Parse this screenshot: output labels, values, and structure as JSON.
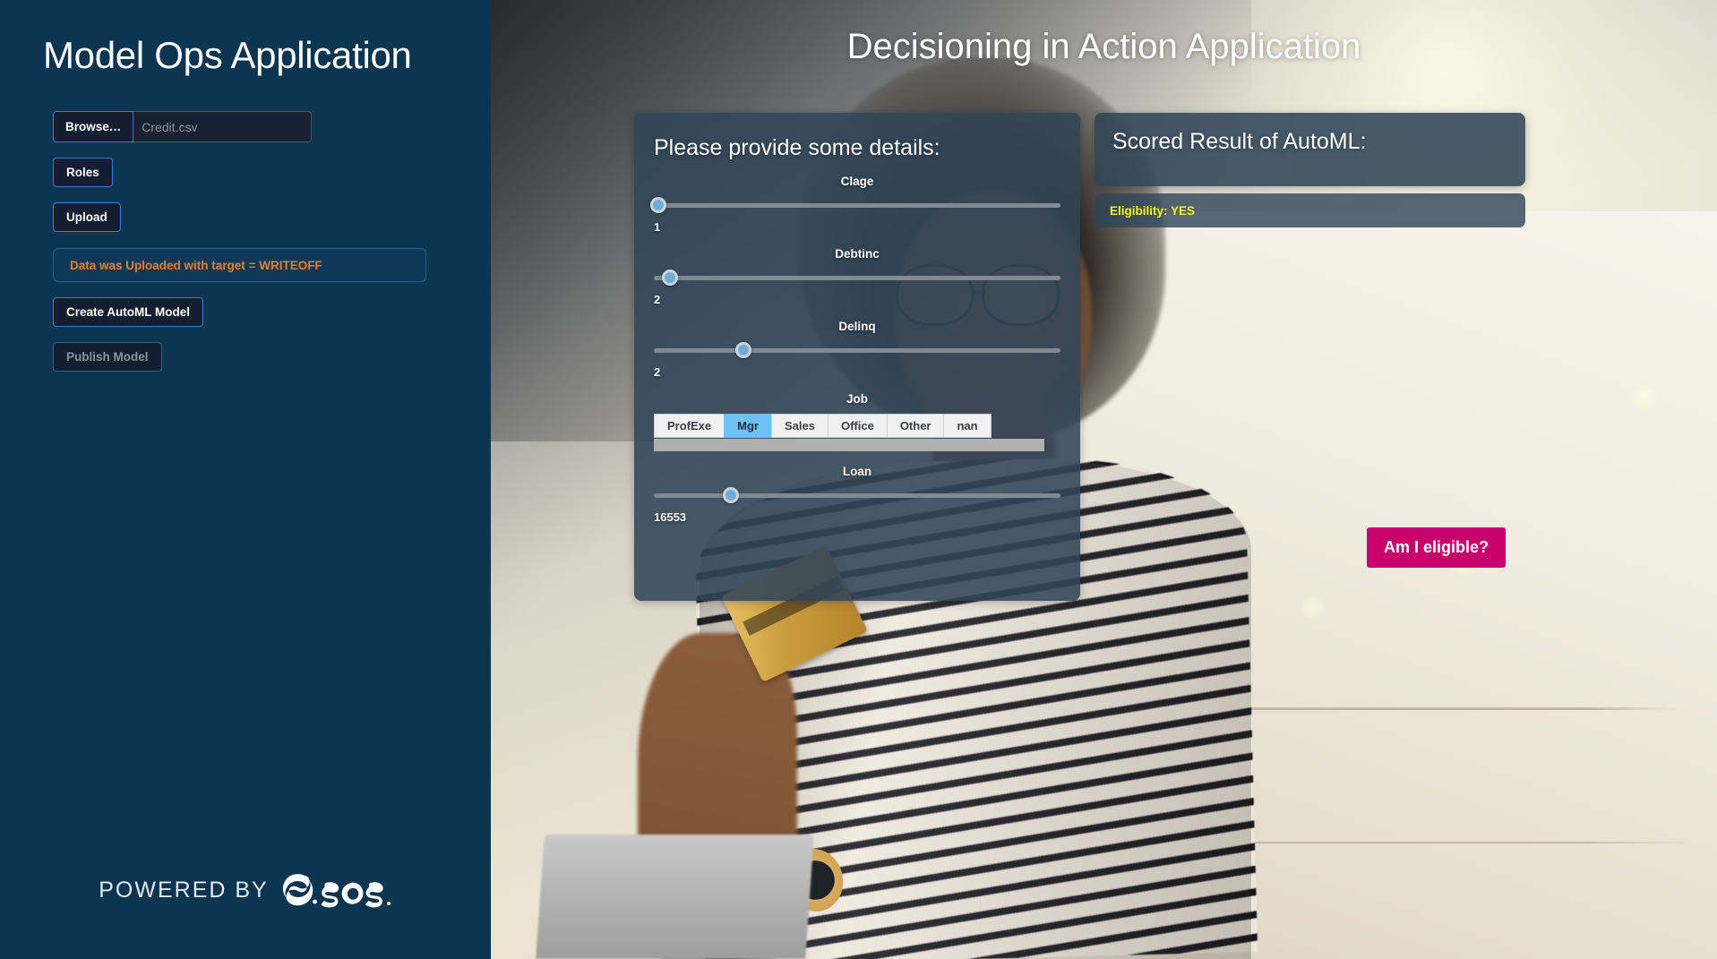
{
  "sidebar": {
    "title": "Model Ops Application",
    "file_input": {
      "browse_label": "Browse…",
      "file_name": "Credit.csv"
    },
    "buttons": [
      {
        "label": "Roles",
        "disabled": false
      },
      {
        "label": "Upload",
        "disabled": false
      }
    ],
    "status": {
      "prefix": "Data was Uploaded with target",
      "equals": "=",
      "value": "WRITEOFF",
      "color": "#e8802b"
    },
    "model_buttons": [
      {
        "label": "Create AutoML Model",
        "disabled": false
      },
      {
        "label": "Publish Model",
        "disabled": true
      }
    ],
    "footer": {
      "powered_by": "POWERED BY",
      "logo_name": "sas-logo",
      "logo_text": ".sas"
    },
    "accent_color": "#3a7bd5",
    "background_color": "#0b3550"
  },
  "main": {
    "title": "Decisioning in Action Application",
    "form_panel": {
      "title": "Please provide some details:",
      "sliders": [
        {
          "name": "Clage",
          "label": "Clage",
          "value": "1",
          "position_pct": 1
        },
        {
          "name": "Debtinc",
          "label": "Debtinc",
          "value": "2",
          "position_pct": 4
        },
        {
          "name": "Delinq",
          "label": "Delinq",
          "value": "2",
          "position_pct": 22
        },
        {
          "name": "Loan",
          "label": "Loan",
          "value": "16553",
          "position_pct": 19
        }
      ],
      "radio_group": {
        "label": "Job",
        "options": [
          "ProfExe",
          "Mgr",
          "Sales",
          "Office",
          "Other",
          "nan"
        ],
        "selected": "Mgr",
        "selected_color": "#6ec1f5"
      },
      "submit_label": "Am I eligible?",
      "submit_color": "#c8006b"
    },
    "result_panel": {
      "title": "Scored Result of AutoML:",
      "result_text": "Eligibility: YES",
      "result_color": "#f7f615"
    }
  }
}
